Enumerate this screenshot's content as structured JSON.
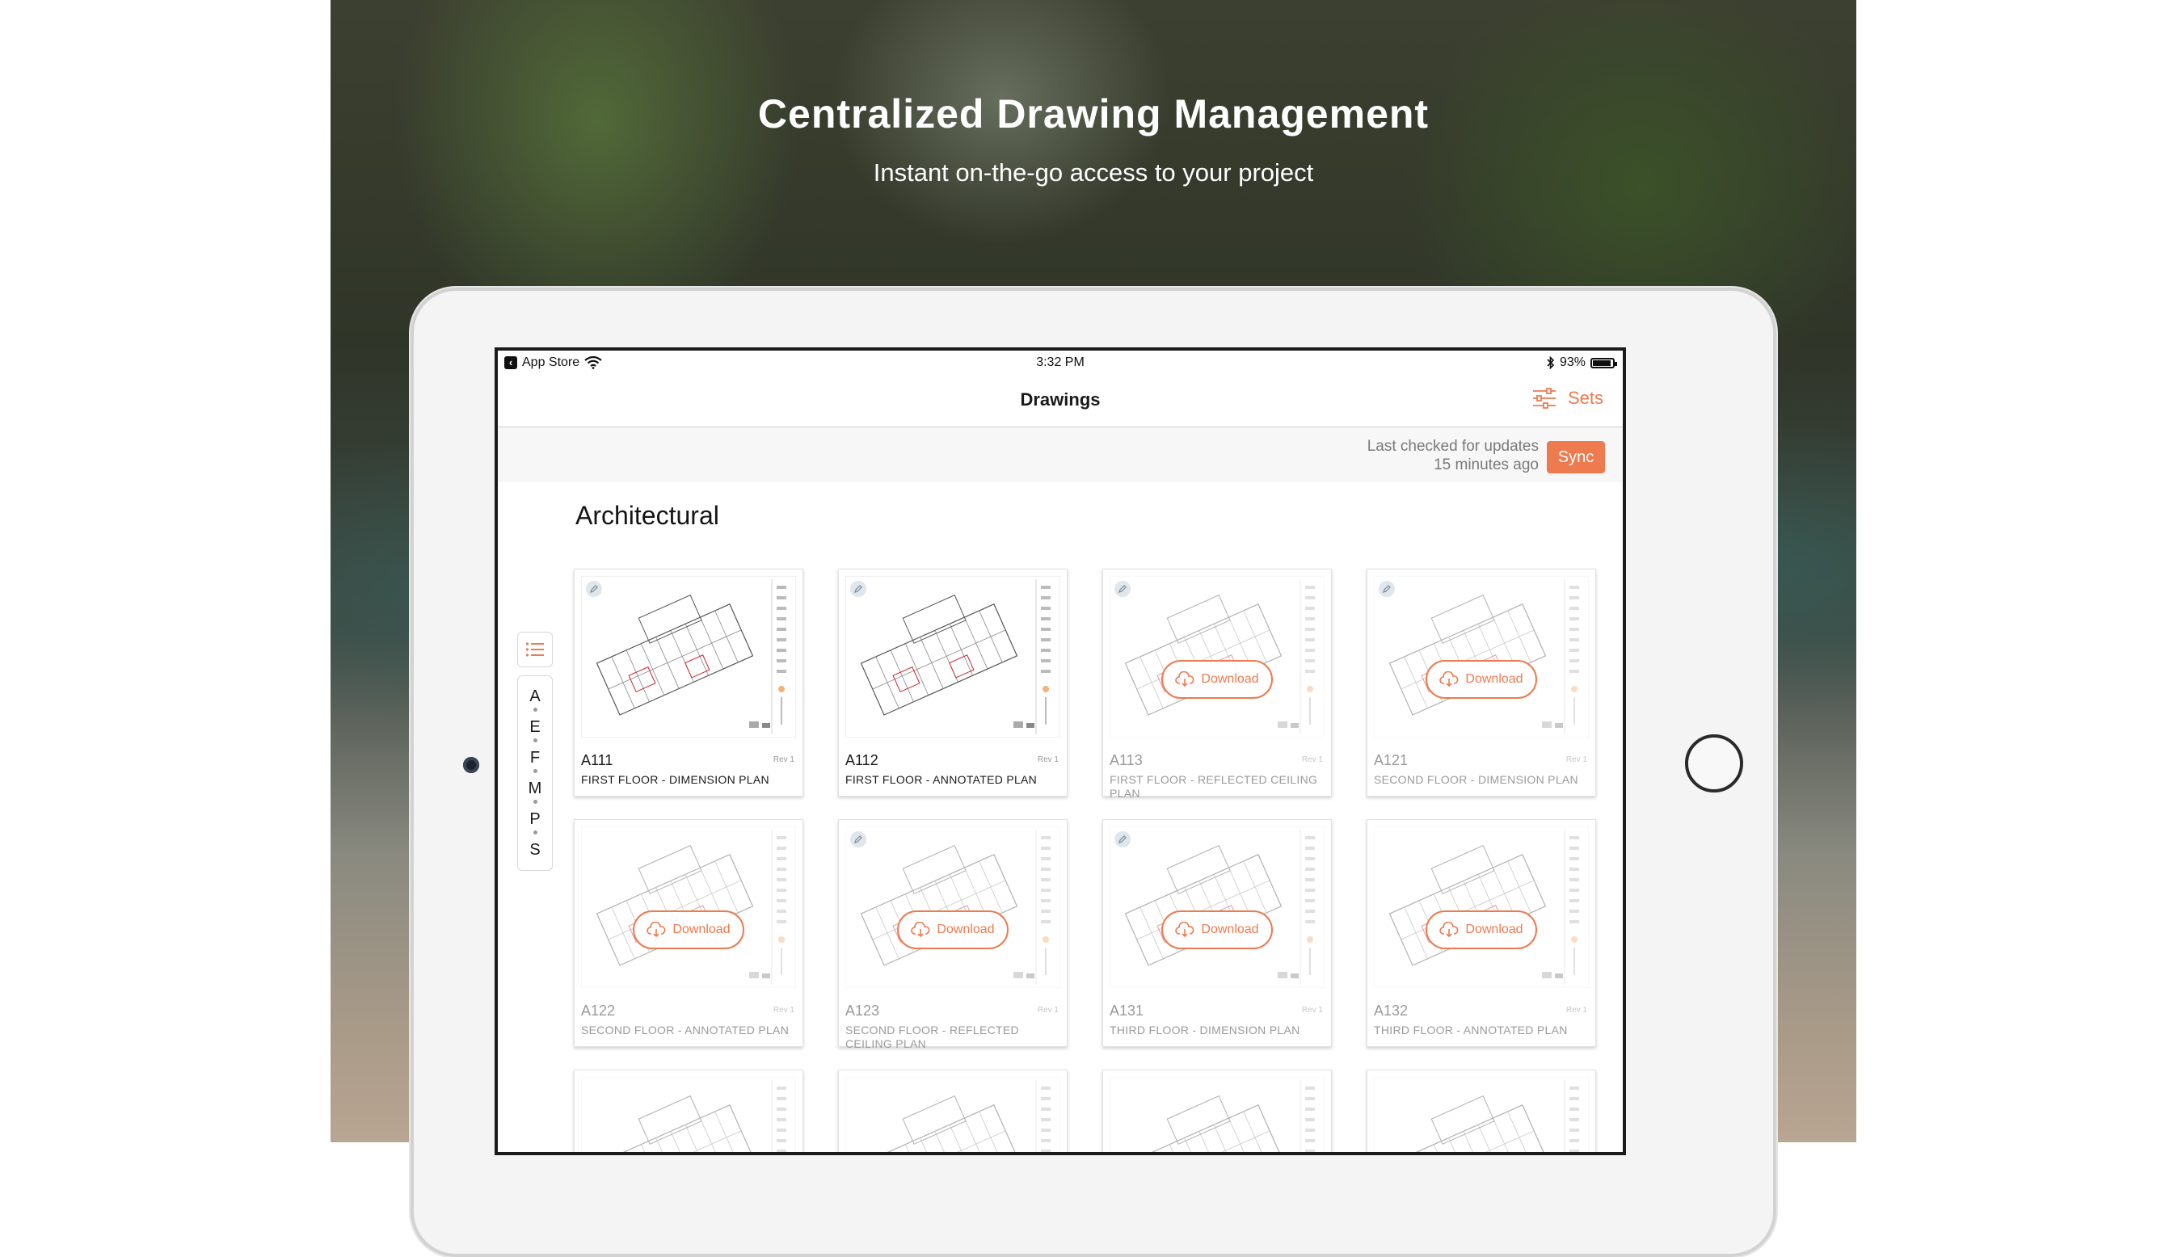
{
  "hero": {
    "title": "Centralized Drawing Management",
    "subtitle": "Instant on-the-go access to your project"
  },
  "status_bar": {
    "back_label": "App Store",
    "time": "3:32 PM",
    "battery": "93%",
    "battery_level": 0.93
  },
  "nav": {
    "title": "Drawings",
    "sets_label": "Sets"
  },
  "sync": {
    "line1": "Last checked for updates",
    "line2": "15 minutes ago",
    "button": "Sync"
  },
  "section_title": "Architectural",
  "index_letters": [
    "A",
    "E",
    "F",
    "M",
    "P",
    "S"
  ],
  "download_label": "Download",
  "drawings": [
    {
      "code": "A111",
      "rev": "Rev 1",
      "name": "FIRST FLOOR - DIMENSION PLAN",
      "downloaded": true,
      "badge": true
    },
    {
      "code": "A112",
      "rev": "Rev 1",
      "name": "FIRST FLOOR - ANNOTATED PLAN",
      "downloaded": true,
      "badge": true
    },
    {
      "code": "A113",
      "rev": "Rev 1",
      "name": "FIRST FLOOR - REFLECTED CEILING PLAN",
      "downloaded": false,
      "badge": true
    },
    {
      "code": "A121",
      "rev": "Rev 1",
      "name": "SECOND FLOOR - DIMENSION PLAN",
      "downloaded": false,
      "badge": true
    },
    {
      "code": "A122",
      "rev": "Rev 1",
      "name": "SECOND FLOOR - ANNOTATED PLAN",
      "downloaded": false,
      "badge": false
    },
    {
      "code": "A123",
      "rev": "Rev 1",
      "name": "SECOND FLOOR - REFLECTED CEILING PLAN",
      "downloaded": false,
      "badge": true
    },
    {
      "code": "A131",
      "rev": "Rev 1",
      "name": "THIRD FLOOR - DIMENSION PLAN",
      "downloaded": false,
      "badge": true
    },
    {
      "code": "A132",
      "rev": "Rev 1",
      "name": "THIRD FLOOR - ANNOTATED PLAN",
      "downloaded": false,
      "badge": false
    }
  ],
  "colors": {
    "accent": "#ee7a4f",
    "text": "#1a1a1a",
    "muted": "#9a9a9a"
  }
}
